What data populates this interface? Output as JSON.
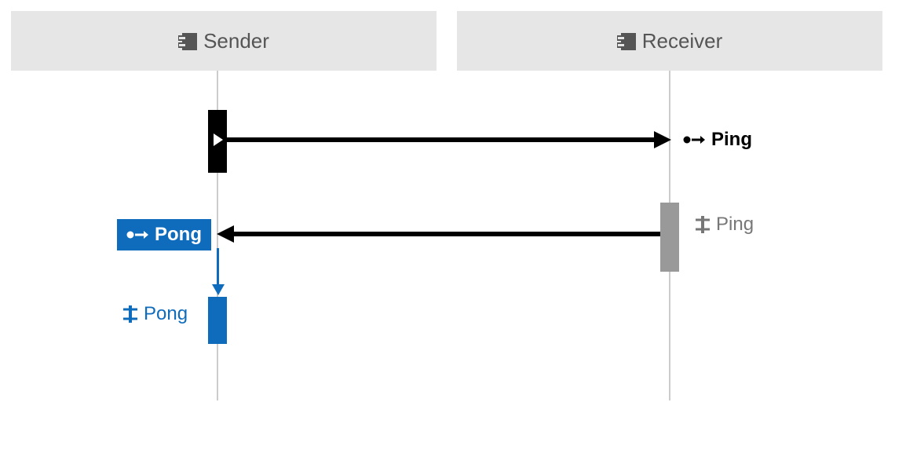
{
  "participants": {
    "sender": {
      "label": "Sender"
    },
    "receiver": {
      "label": "Receiver"
    }
  },
  "messages": {
    "ping_send": {
      "label": "Ping"
    },
    "ping_recv": {
      "label": "Ping"
    },
    "pong_send": {
      "label": "Pong"
    },
    "pong_recv": {
      "label": "Pong"
    }
  },
  "colors": {
    "accent": "#0f6cbd",
    "text_primary": "#000",
    "text_secondary": "#555",
    "text_muted": "#888",
    "box_bg": "#e6e6e6",
    "inactive": "#999"
  }
}
